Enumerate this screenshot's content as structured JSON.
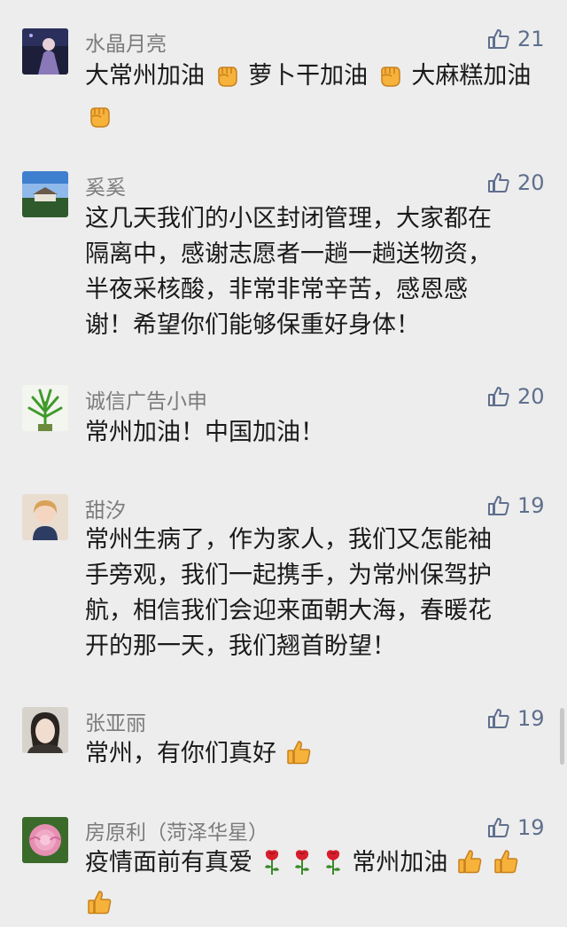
{
  "comments": [
    {
      "name": "水晶月亮",
      "likes": "21",
      "lines": [
        [
          "大常州加油",
          "fist",
          "萝卜干加油",
          "fist",
          "大麻糕加油"
        ],
        [
          "fist"
        ]
      ]
    },
    {
      "name": "奚奚",
      "likes": "20",
      "lines": [
        [
          "这几天我们的小区封闭管理，大家都在"
        ],
        [
          "隔离中，感谢志愿者一趟一趟送物资，"
        ],
        [
          "半夜采核酸，非常非常辛苦，感恩感"
        ],
        [
          "谢！希望你们能够保重好身体！"
        ]
      ]
    },
    {
      "name": "诚信广告小申",
      "likes": "20",
      "lines": [
        [
          "常州加油！中国加油！"
        ]
      ]
    },
    {
      "name": "甜汐",
      "likes": "19",
      "lines": [
        [
          "常州生病了，作为家人，我们又怎能袖"
        ],
        [
          "手旁观，我们一起携手，为常州保驾护"
        ],
        [
          "航，相信我们会迎来面朝大海，春暖花"
        ],
        [
          "开的那一天，我们翘首盼望！"
        ]
      ]
    },
    {
      "name": "张亚丽",
      "likes": "19",
      "lines": [
        [
          "常州，有你们真好",
          "thumbs"
        ]
      ]
    },
    {
      "name": "房原利（菏泽华星）",
      "likes": "19",
      "lines": [
        [
          "疫情面前有真爱",
          "rose",
          "rose",
          "rose",
          "常州加油",
          "thumbs",
          "thumbs"
        ],
        [
          "thumbs"
        ]
      ]
    }
  ],
  "icons": {
    "like": "thumbs-up-outline-icon",
    "fist": "raised-fist-emoji",
    "thumbs": "thumbs-up-emoji",
    "rose": "rose-emoji"
  },
  "colors": {
    "background": "#ededed",
    "name": "#7b7b7b",
    "like": "#5f6f8d",
    "text": "#1a1a1a"
  }
}
